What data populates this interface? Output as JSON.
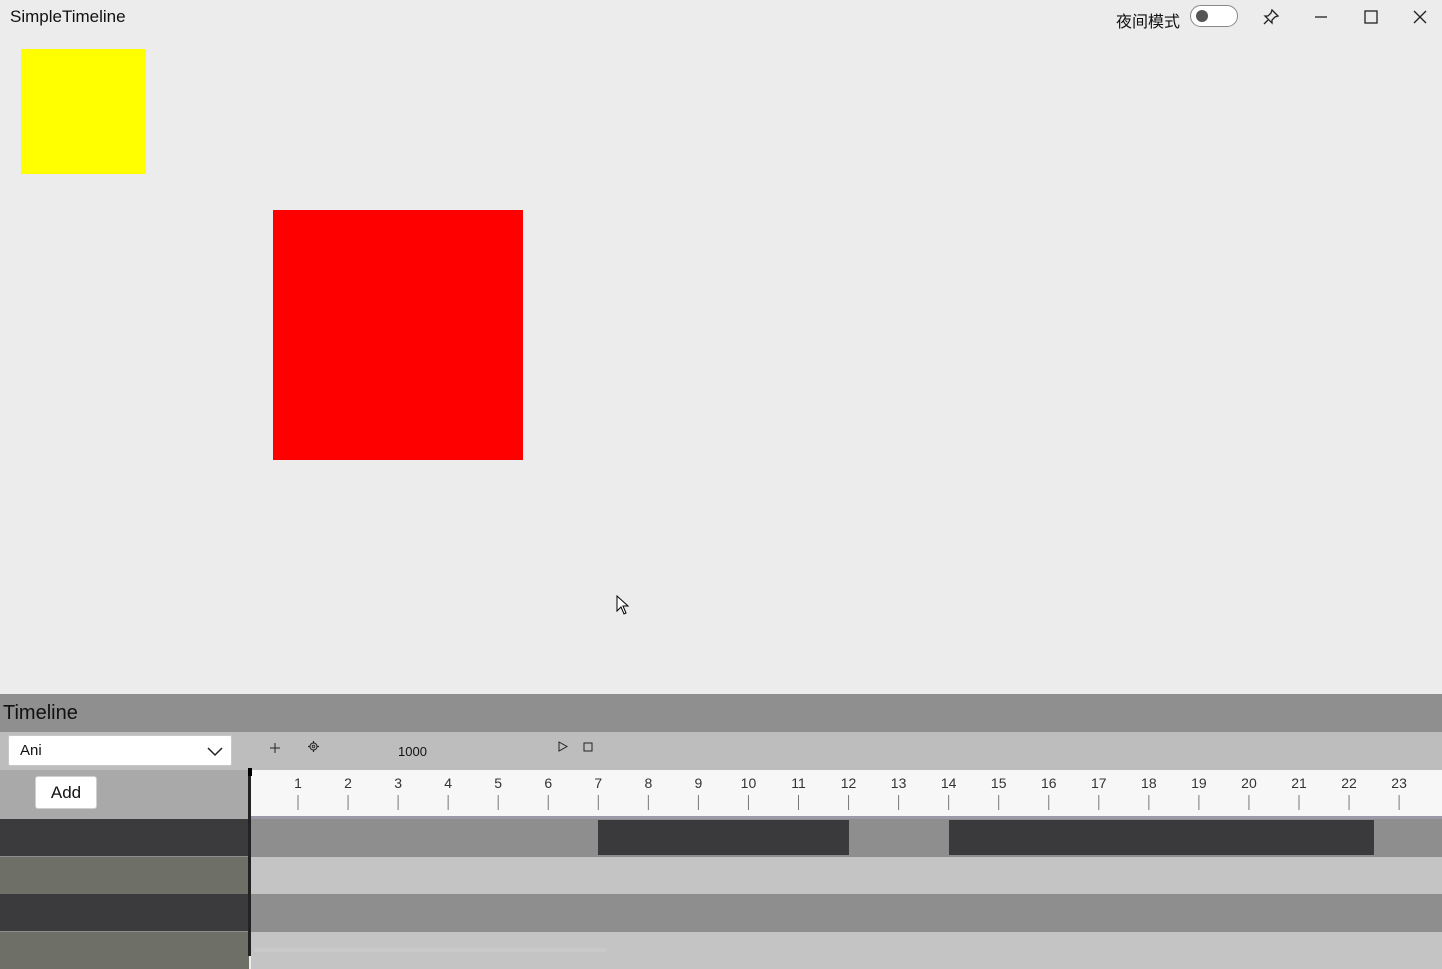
{
  "window": {
    "title": "SimpleTimeline",
    "night_mode_label": "夜间模式",
    "night_mode_on": false,
    "icons": [
      "pin-icon",
      "minimize-icon",
      "maximize-icon",
      "close-icon"
    ]
  },
  "canvas": {
    "items": [
      {
        "name": "yellow-square",
        "color": "#ffff00"
      },
      {
        "name": "red-square",
        "color": "#ff0000"
      }
    ]
  },
  "timeline": {
    "title": "Timeline",
    "animation_select": {
      "value": "Ani"
    },
    "toolbar_icons": [
      "add-icon",
      "settings-icon",
      "play-icon",
      "stop-icon"
    ],
    "duration": "1000",
    "add_button": "Add",
    "ruler_ticks": [
      "1",
      "2",
      "3",
      "4",
      "5",
      "6",
      "7",
      "8",
      "9",
      "10",
      "11",
      "12",
      "13",
      "14",
      "15",
      "16",
      "17",
      "18",
      "19",
      "20",
      "21",
      "22",
      "23"
    ],
    "tracks": [
      {
        "clips": [
          {
            "start": 7,
            "end": 12
          },
          {
            "start": 14,
            "end": 22.5
          }
        ]
      },
      {
        "clips": []
      },
      {
        "clips": []
      },
      {
        "clips": []
      }
    ]
  },
  "colors": {
    "clip": "#3a3a3c",
    "track_dark": "#8e8e8e",
    "track_light": "#c4c4c4",
    "left_dark": "#3b3b3d",
    "left_light": "#6e6f66"
  }
}
